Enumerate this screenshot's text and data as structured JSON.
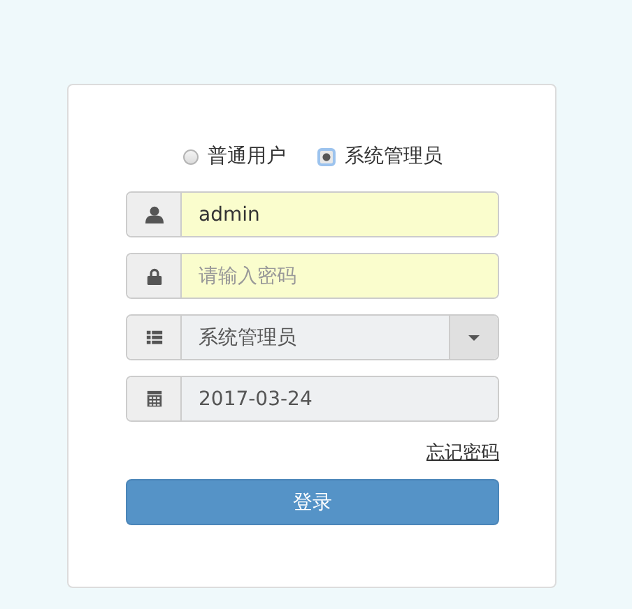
{
  "user_types": [
    {
      "label": "普通用户",
      "selected": false
    },
    {
      "label": "系统管理员",
      "selected": true
    }
  ],
  "fields": [
    {
      "kind": "username",
      "value": "admin",
      "autofilled": true
    },
    {
      "kind": "password",
      "placeholder": "请输入密码",
      "autofilled": true
    },
    {
      "kind": "select",
      "value": "系统管理员"
    },
    {
      "kind": "date",
      "value": "2017-03-24"
    }
  ],
  "forgot_link": "忘记密码",
  "submit_button": "登录"
}
